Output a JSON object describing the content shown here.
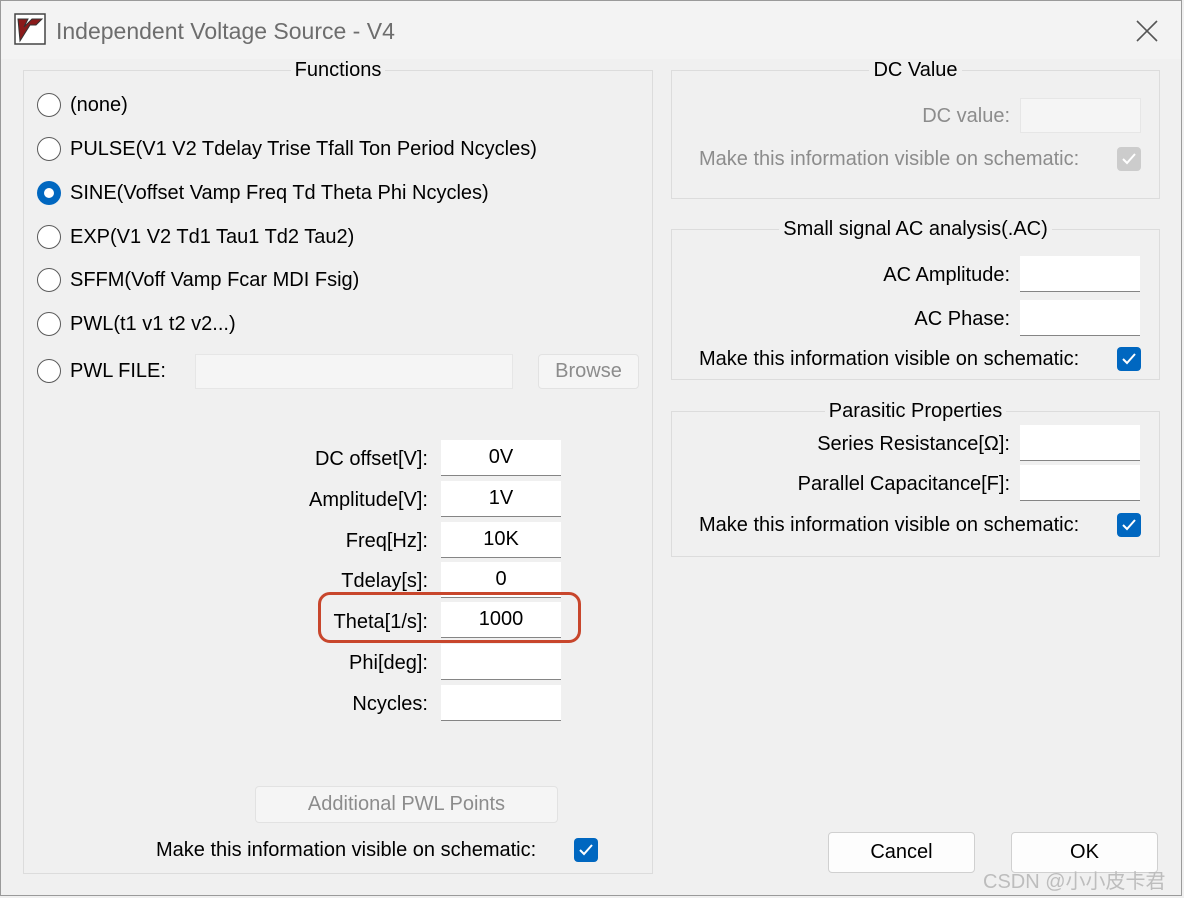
{
  "window": {
    "title": "Independent Voltage Source - V4",
    "close_icon": "close-icon",
    "logo_icon": "ltspice-logo-icon"
  },
  "functions": {
    "legend": "Functions",
    "options": [
      {
        "label": "(none)",
        "checked": false
      },
      {
        "label": "PULSE(V1 V2 Tdelay Trise Tfall Ton Period Ncycles)",
        "checked": false
      },
      {
        "label": "SINE(Voffset Vamp Freq Td Theta Phi Ncycles)",
        "checked": true
      },
      {
        "label": "EXP(V1 V2 Td1 Tau1 Td2 Tau2)",
        "checked": false
      },
      {
        "label": "SFFM(Voff Vamp Fcar MDI Fsig)",
        "checked": false
      },
      {
        "label": "PWL(t1 v1 t2 v2...)",
        "checked": false
      },
      {
        "label": "PWL FILE:",
        "checked": false
      }
    ],
    "pwl_file_value": "",
    "browse_label": "Browse",
    "params": [
      {
        "label": "DC offset[V]:",
        "value": "0V"
      },
      {
        "label": "Amplitude[V]:",
        "value": "1V"
      },
      {
        "label": "Freq[Hz]:",
        "value": "10K"
      },
      {
        "label": "Tdelay[s]:",
        "value": "0"
      },
      {
        "label": "Theta[1/s]:",
        "value": "1000"
      },
      {
        "label": "Phi[deg]:",
        "value": ""
      },
      {
        "label": "Ncycles:",
        "value": ""
      }
    ],
    "additional_pwl_label": "Additional PWL Points",
    "visible_label": "Make this information visible on schematic:",
    "visible_checked": true
  },
  "dc_value": {
    "legend": "DC Value",
    "dc_label": "DC value:",
    "dc_value": "",
    "visible_label": "Make this information visible on schematic:",
    "visible_checked": true
  },
  "ac": {
    "legend": "Small signal AC analysis(.AC)",
    "amplitude_label": "AC Amplitude:",
    "amplitude_value": "",
    "phase_label": "AC Phase:",
    "phase_value": "",
    "visible_label": "Make this information visible on schematic:",
    "visible_checked": true
  },
  "parasitic": {
    "legend": "Parasitic Properties",
    "series_label": "Series Resistance[Ω]:",
    "series_value": "",
    "parallel_label": "Parallel Capacitance[F]:",
    "parallel_value": "",
    "visible_label": "Make this information visible on schematic:",
    "visible_checked": true
  },
  "buttons": {
    "cancel": "Cancel",
    "ok": "OK"
  },
  "watermark": "CSDN @小小皮卡君",
  "colors": {
    "accent": "#0067c0",
    "highlight": "#c8462c"
  }
}
